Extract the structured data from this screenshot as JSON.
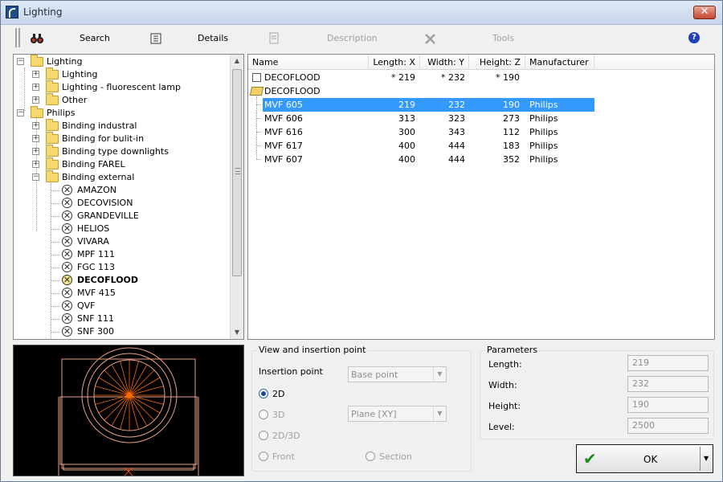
{
  "window": {
    "title": "Lighting"
  },
  "toolbar": {
    "search_label": "Search",
    "details_label": "Details",
    "description_label": "Description",
    "tools_label": "Tools"
  },
  "tree": {
    "root1": "Lighting",
    "root1_children": [
      "Lighting",
      "Lighting - fluorescent lamp",
      "Other"
    ],
    "root2": "Philips",
    "root2_children": [
      "Binding industral",
      "Binding for bulit-in",
      "Binding type downlights",
      "Binding FAREL",
      "Binding external"
    ],
    "leaves": [
      "AMAZON",
      "DECOVISION",
      "GRANDEVILLE",
      "HELIOS",
      "VIVARA",
      "MPF 111",
      "FGC 113",
      "DECOFLOOD",
      "MVF 415",
      "QVF",
      "SNF 111",
      "SNF 300"
    ],
    "selected_leaf": "DECOFLOOD"
  },
  "list": {
    "columns": [
      "Name",
      "Length: X",
      "Width: Y",
      "Height: Z",
      "Manufacturer"
    ],
    "group_row": {
      "name": "DECOFLOOD",
      "length": "* 219",
      "width": "* 232",
      "height": "* 190"
    },
    "folder_row": "DECOFLOOD",
    "rows": [
      {
        "name": "MVF 605",
        "length": "219",
        "width": "232",
        "height": "190",
        "manufacturer": "Philips"
      },
      {
        "name": "MVF 606",
        "length": "313",
        "width": "323",
        "height": "273",
        "manufacturer": "Philips"
      },
      {
        "name": "MVF 616",
        "length": "300",
        "width": "343",
        "height": "112",
        "manufacturer": "Philips"
      },
      {
        "name": "MVF 617",
        "length": "400",
        "width": "444",
        "height": "183",
        "manufacturer": "Philips"
      },
      {
        "name": "MVF 607",
        "length": "400",
        "width": "444",
        "height": "352",
        "manufacturer": "Philips"
      }
    ],
    "selected_index": 0
  },
  "view_group": {
    "title": "View and insertion point",
    "insertion_label": "Insertion point",
    "insertion_value": "Base point",
    "plane_value": "Plane  [XY]",
    "radio_2d": "2D",
    "radio_3d": "3D",
    "radio_2d3d": "2D/3D",
    "radio_front": "Front",
    "radio_section": "Section",
    "selected": "2D"
  },
  "params": {
    "title": "Parameters",
    "length_label": "Length:",
    "length_value": "219",
    "width_label": "Width:",
    "width_value": "232",
    "height_label": "Height:",
    "height_value": "190",
    "level_label": "Level:",
    "level_value": "2500"
  },
  "ok_label": "OK",
  "colors": {
    "selection": "#3399ff",
    "preview_lines": "#e9a08a",
    "preview_rays": "#ff6a00",
    "preview_bg": "#000000"
  }
}
